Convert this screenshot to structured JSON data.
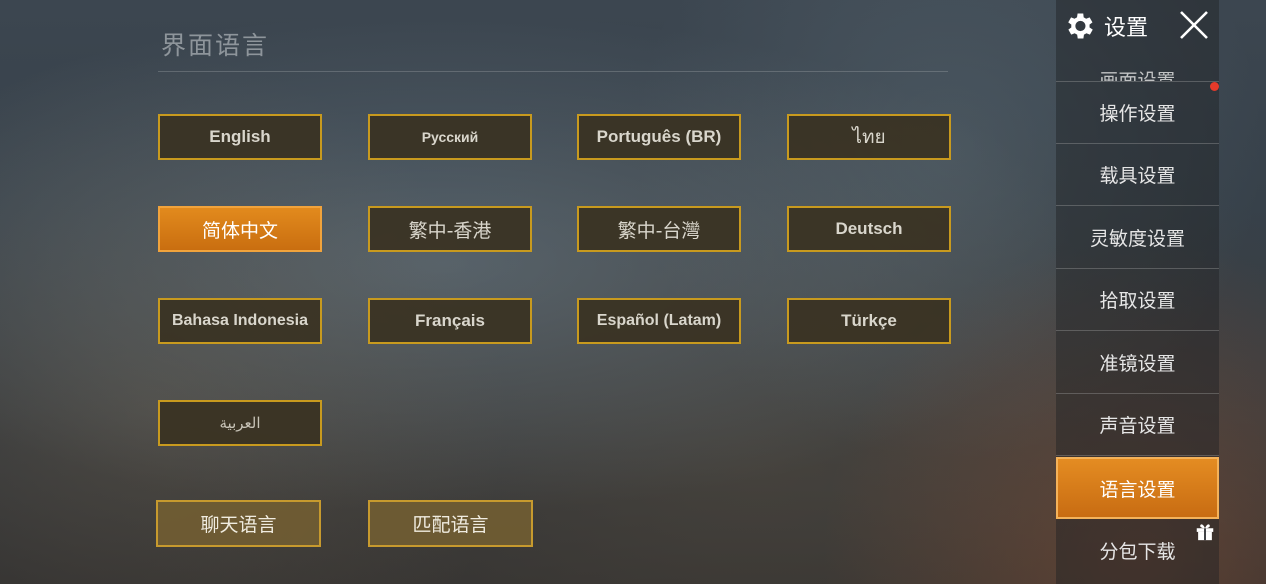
{
  "header": {
    "title": "设置",
    "gear_icon": "gear-icon",
    "close_icon": "close-icon"
  },
  "section": {
    "title": "界面语言"
  },
  "languages": [
    {
      "label": "English",
      "selected": false
    },
    {
      "label": "Русский",
      "selected": false
    },
    {
      "label": "Português (BR)",
      "selected": false
    },
    {
      "label": "ไทย",
      "selected": false
    },
    {
      "label": "简体中文",
      "selected": true
    },
    {
      "label": "繁中-香港",
      "selected": false
    },
    {
      "label": "繁中-台灣",
      "selected": false
    },
    {
      "label": "Deutsch",
      "selected": false
    },
    {
      "label": "Bahasa Indonesia",
      "selected": false
    },
    {
      "label": "Français",
      "selected": false
    },
    {
      "label": "Español (Latam)",
      "selected": false
    },
    {
      "label": "Türkçe",
      "selected": false
    },
    {
      "label": "العربية",
      "selected": false
    }
  ],
  "sub_buttons": {
    "chat_language": "聊天语言",
    "match_language": "匹配语言"
  },
  "sidebar": {
    "items": [
      {
        "label": "画面设置",
        "active": false
      },
      {
        "label": "操作设置",
        "active": false,
        "notification": true
      },
      {
        "label": "载具设置",
        "active": false
      },
      {
        "label": "灵敏度设置",
        "active": false
      },
      {
        "label": "拾取设置",
        "active": false
      },
      {
        "label": "准镜设置",
        "active": false
      },
      {
        "label": "声音设置",
        "active": false
      },
      {
        "label": "语言设置",
        "active": true
      },
      {
        "label": "分包下载",
        "active": false
      }
    ]
  },
  "colors": {
    "accent_orange": "#e28a1d",
    "button_border_gold": "#c89a1e",
    "notification_red": "#e53a2a"
  }
}
